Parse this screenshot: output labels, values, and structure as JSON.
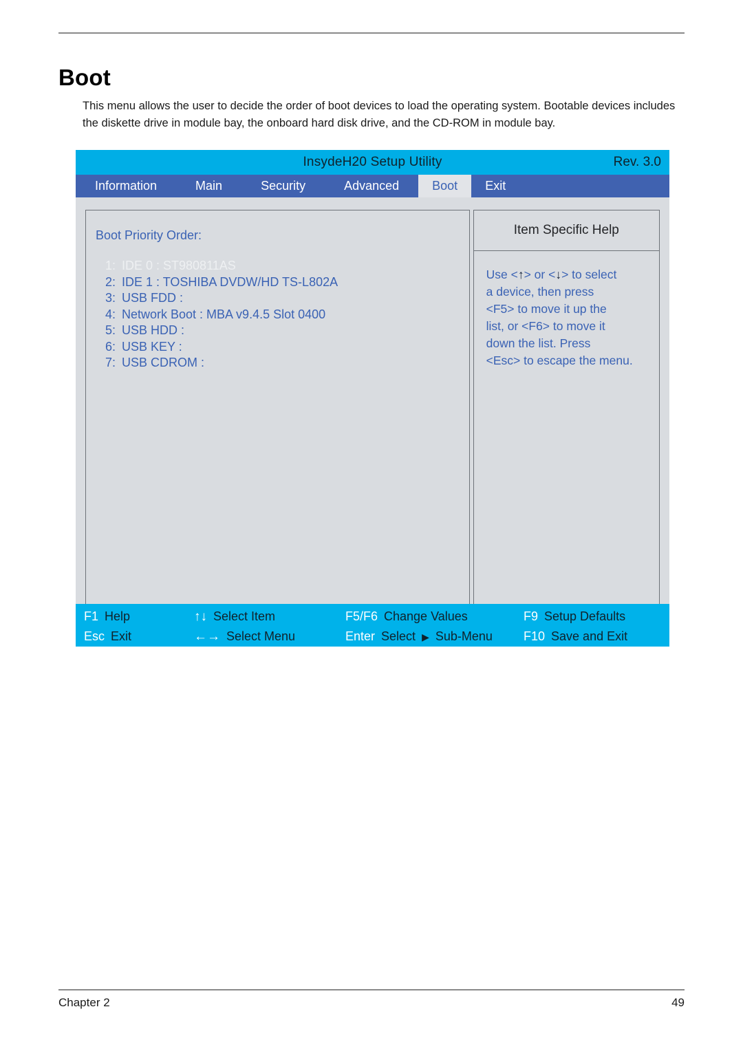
{
  "document": {
    "title": "Boot",
    "intro": "This menu allows the user to decide the order of boot devices to load the operating system. Bootable devices includes the diskette drive in module bay, the onboard hard disk drive, and the CD-ROM in module bay.",
    "footer_left": "Chapter 2",
    "footer_right": "49"
  },
  "bios": {
    "title": "InsydeH20 Setup Utility",
    "revision": "Rev. 3.0",
    "tabs": [
      {
        "label": "Information",
        "active": false
      },
      {
        "label": "Main",
        "active": false
      },
      {
        "label": "Security",
        "active": false
      },
      {
        "label": "Advanced",
        "active": false
      },
      {
        "label": "Boot",
        "active": true
      },
      {
        "label": "Exit",
        "active": false
      }
    ],
    "boot_priority_label": "Boot Priority Order:",
    "boot_items": [
      {
        "index": "1:",
        "label": "IDE 0 : ST980811AS",
        "selected": true
      },
      {
        "index": "2:",
        "label": "IDE 1 : TOSHIBA DVDW/HD TS-L802A",
        "selected": false
      },
      {
        "index": "3:",
        "label": "USB FDD :",
        "selected": false
      },
      {
        "index": "4:",
        "label": "Network Boot : MBA v9.4.5 Slot 0400",
        "selected": false
      },
      {
        "index": "5:",
        "label": "USB HDD :",
        "selected": false
      },
      {
        "index": "6:",
        "label": "USB KEY :",
        "selected": false
      },
      {
        "index": "7:",
        "label": "USB CDROM :",
        "selected": false
      }
    ],
    "help": {
      "header": "Item Specific Help",
      "line1_a": "Use <",
      "line1_up": "↑",
      "line1_b": "> or <",
      "line1_down": "↓",
      "line1_c": "> to select",
      "line2": "a device, then press",
      "line3": "<F5> to move it up the",
      "line4": "list, or <F6> to move it",
      "line5": "down the list. Press",
      "line6": "<Esc> to escape the menu."
    },
    "keybar": [
      {
        "key": "F1",
        "desc": "Help"
      },
      {
        "key": "↑↓",
        "desc": "Select Item",
        "symbol": true
      },
      {
        "key": "F5/F6",
        "desc": "Change Values"
      },
      {
        "key": "F9",
        "desc": "Setup Defaults"
      },
      {
        "key": "Esc",
        "desc": "Exit"
      },
      {
        "key": "←→",
        "desc": "Select Menu",
        "symbol": true
      },
      {
        "key": "Enter",
        "desc_pre": "Select",
        "desc_arrow": "▶",
        "desc_post": "Sub-Menu"
      },
      {
        "key": "F10",
        "desc": "Save and Exit"
      }
    ]
  },
  "colors": {
    "titlebar": "#00aee6",
    "tabbar": "#4062b0",
    "accent_blue_text": "#3a62b4",
    "panel_bg": "#d9dce0",
    "keybar": "#00b2ea"
  }
}
